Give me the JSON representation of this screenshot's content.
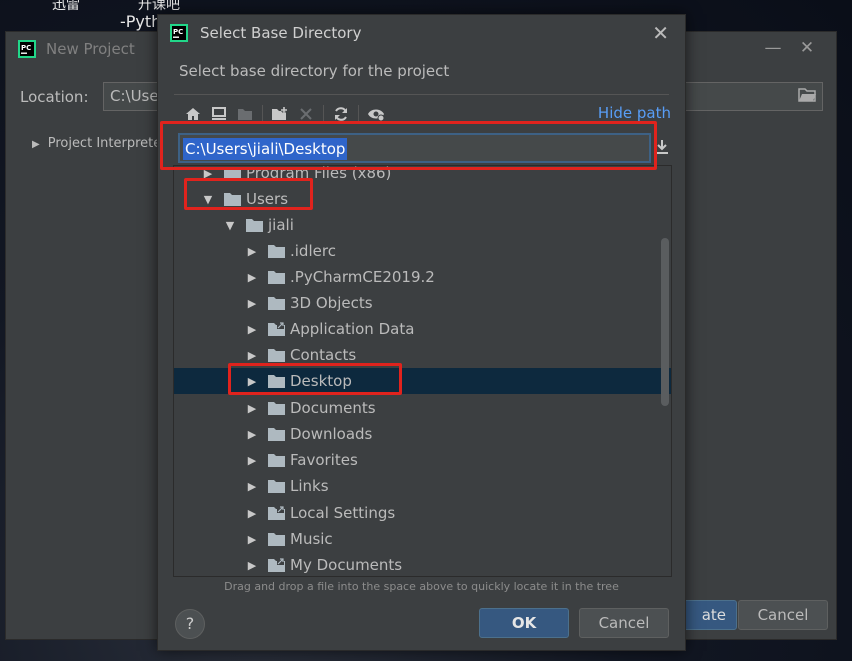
{
  "desktop": {
    "text_top": "迅雷",
    "text_top2": "升课吧",
    "text_python": "-Pyth"
  },
  "bg_window": {
    "title": "New Project",
    "location_label": "Location:",
    "location_value": "C:\\User",
    "interpreter_label": "Project Interprete",
    "create_label": "ate",
    "cancel_label": "Cancel"
  },
  "dialog": {
    "title": "Select Base Directory",
    "description": "Select base directory for the project",
    "hide_path": "Hide path",
    "path_value": "C:\\Users\\jiali\\Desktop",
    "hint": "Drag and drop a file into the space above to quickly locate it in the tree",
    "ok_label": "OK",
    "cancel_label": "Cancel",
    "help_label": "?"
  },
  "tree": {
    "items": [
      {
        "label": "Program Files (x86)",
        "expanded": false
      },
      {
        "label": "Users",
        "expanded": true
      },
      {
        "label": "jiali",
        "expanded": true
      },
      {
        "label": ".idlerc",
        "expanded": false
      },
      {
        "label": ".PyCharmCE2019.2",
        "expanded": false
      },
      {
        "label": "3D Objects",
        "expanded": false
      },
      {
        "label": "Application Data",
        "expanded": false,
        "link": true
      },
      {
        "label": "Contacts",
        "expanded": false
      },
      {
        "label": "Desktop",
        "expanded": false,
        "selected": true
      },
      {
        "label": "Documents",
        "expanded": false
      },
      {
        "label": "Downloads",
        "expanded": false
      },
      {
        "label": "Favorites",
        "expanded": false
      },
      {
        "label": "Links",
        "expanded": false
      },
      {
        "label": "Local Settings",
        "expanded": false,
        "link": true
      },
      {
        "label": "Music",
        "expanded": false
      },
      {
        "label": "My Documents",
        "expanded": false,
        "link": true
      }
    ]
  },
  "colors": {
    "accent_link": "#589df6",
    "selection": "#0d293e",
    "highlight": "#e0231d",
    "ok_button": "#365880"
  }
}
